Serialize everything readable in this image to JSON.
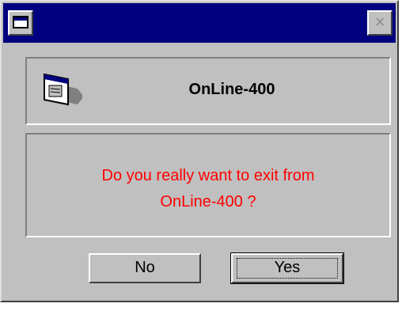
{
  "window": {
    "title_icon": "window-icon",
    "close_label": "×"
  },
  "header": {
    "app_icon": "program-window-icon",
    "title": "OnLine-400"
  },
  "message": {
    "line1": "Do you really want to exit from",
    "line2": "OnLine-400 ?"
  },
  "buttons": {
    "no_label": "No",
    "yes_label": "Yes"
  },
  "colors": {
    "titlebar": "#000080",
    "face": "#c0c0c0",
    "message_text": "#ff0000"
  }
}
